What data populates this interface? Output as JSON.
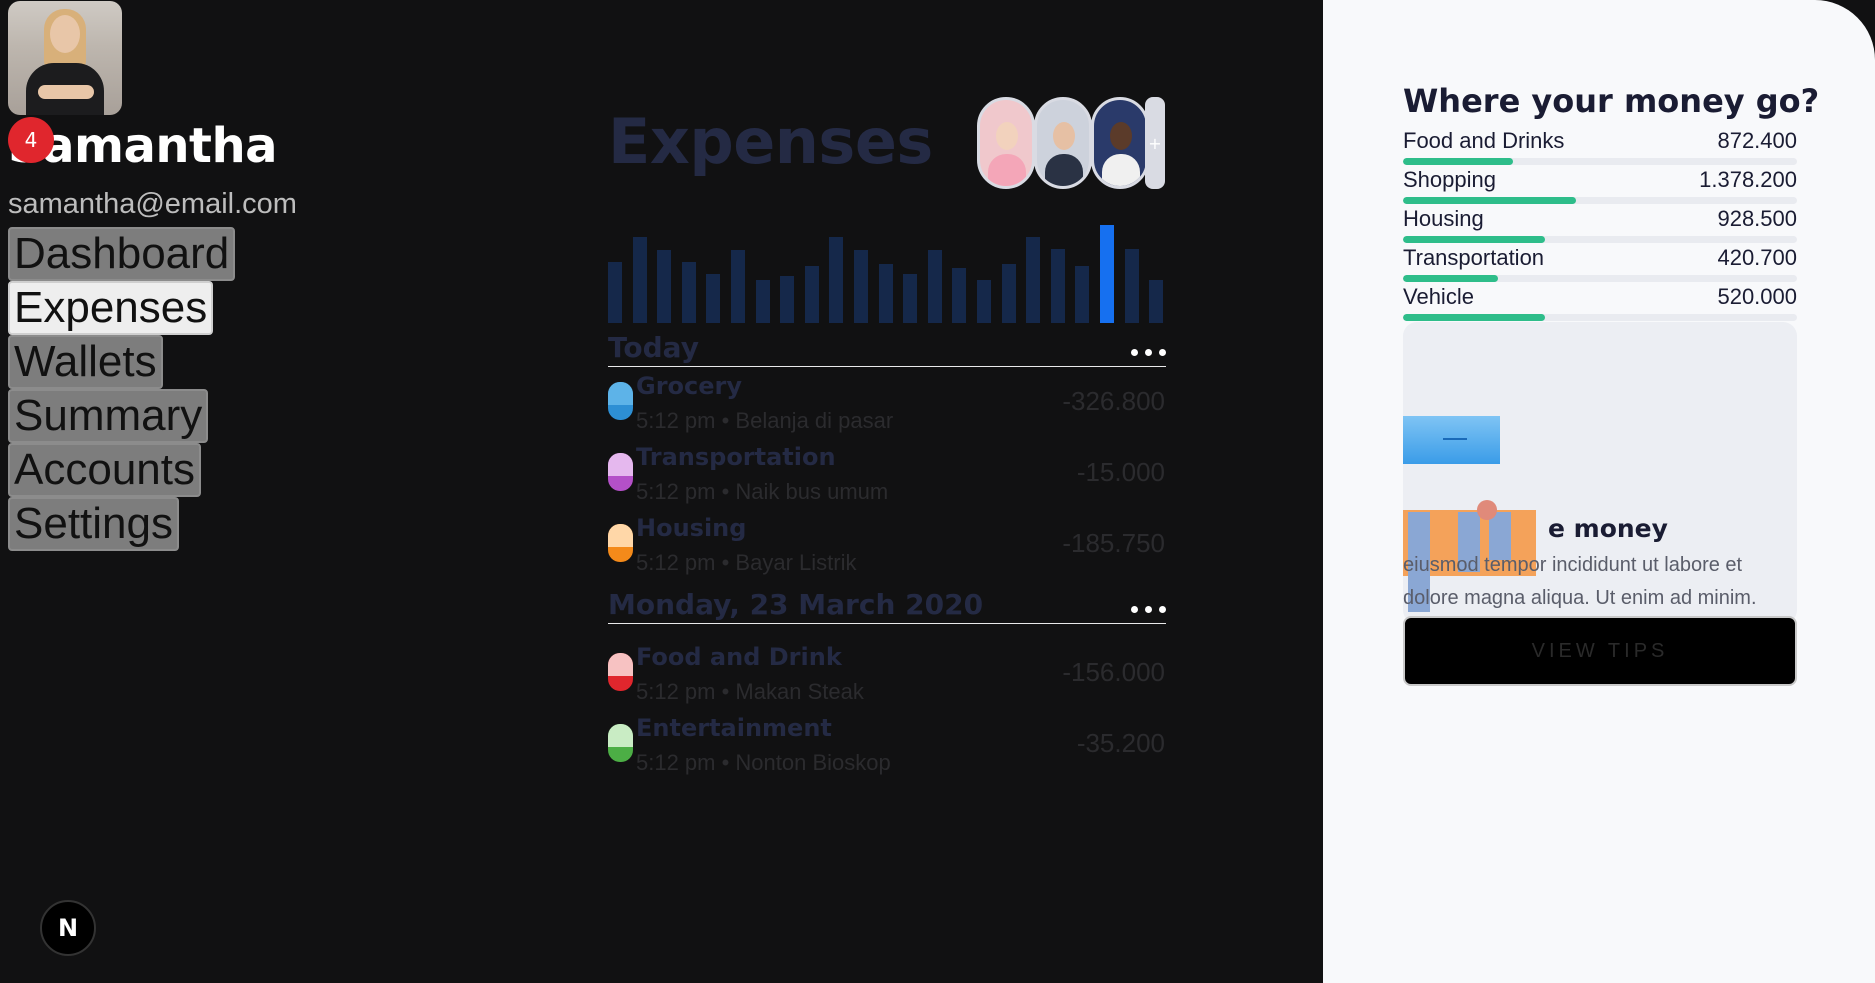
{
  "profile": {
    "name": "Samantha",
    "email": "samantha@email.com",
    "notification_count": "4"
  },
  "nav": {
    "items": [
      {
        "label": "Dashboard",
        "active": false
      },
      {
        "label": "Expenses",
        "active": true
      },
      {
        "label": "Wallets",
        "active": false
      },
      {
        "label": "Summary",
        "active": false
      },
      {
        "label": "Accounts",
        "active": false
      },
      {
        "label": "Settings",
        "active": false
      }
    ]
  },
  "expenses": {
    "title": "Expenses",
    "contacts": [
      {
        "icon": "contact-avatar-1"
      },
      {
        "icon": "contact-avatar-2"
      },
      {
        "icon": "contact-avatar-3"
      }
    ],
    "add_contact_label": "+",
    "activity_bars": [
      0.62,
      0.88,
      0.74,
      0.62,
      0.5,
      0.74,
      0.44,
      0.48,
      0.58,
      0.88,
      0.74,
      0.6,
      0.5,
      0.74,
      0.56,
      0.44,
      0.6,
      0.88,
      0.76,
      0.58,
      1.0,
      0.76,
      0.44
    ],
    "active_bar_index": 20,
    "sections": [
      {
        "label": "Today",
        "transactions": [
          {
            "title": "Grocery",
            "subtitle": "5:12 pm • Belanja di pasar",
            "amount": "-326.800",
            "color_top": "#5db3e8",
            "color_bottom": "#2d8fd4",
            "icon": "grocery-icon"
          },
          {
            "title": "Transportation",
            "subtitle": "5:12 pm • Naik bus umum",
            "amount": "-15.000",
            "color_top": "#e5b8ee",
            "color_bottom": "#b450c8",
            "icon": "transportation-icon"
          },
          {
            "title": "Housing",
            "subtitle": "5:12 pm • Bayar Listrik",
            "amount": "-185.750",
            "color_top": "#ffd7a8",
            "color_bottom": "#f48a1a",
            "icon": "housing-icon"
          }
        ]
      },
      {
        "label": "Monday, 23 March 2020",
        "transactions": [
          {
            "title": "Food and Drink",
            "subtitle": "5:12 pm • Makan Steak",
            "amount": "-156.000",
            "color_top": "#f7c2c2",
            "color_bottom": "#e0262d",
            "icon": "food-drink-icon"
          },
          {
            "title": "Entertainment",
            "subtitle": "5:12 pm • Nonton Bioskop",
            "amount": "-35.200",
            "color_top": "#c9ecc4",
            "color_bottom": "#4cae45",
            "icon": "entertainment-icon"
          }
        ]
      }
    ]
  },
  "spending": {
    "title": "Where your money go?",
    "categories": [
      {
        "label": "Food and Drinks",
        "value": "872.400",
        "fill": 0.28
      },
      {
        "label": "Shopping",
        "value": "1.378.200",
        "fill": 0.44
      },
      {
        "label": "Housing",
        "value": "928.500",
        "fill": 0.36
      },
      {
        "label": "Transportation",
        "value": "420.700",
        "fill": 0.24
      },
      {
        "label": "Vehicle",
        "value": "520.000",
        "fill": 0.36
      }
    ],
    "tip_heading": "e money",
    "tip_body": "eiusmod tempor incididunt ut labore et dolore magna aliqua. Ut enim ad minim.",
    "tip_button": "VIEW TIPS"
  },
  "colors": {
    "background": "#111112",
    "accent_blue": "#1670f0",
    "accent_green": "#2ebd8a",
    "badge_red": "#e0262d"
  }
}
